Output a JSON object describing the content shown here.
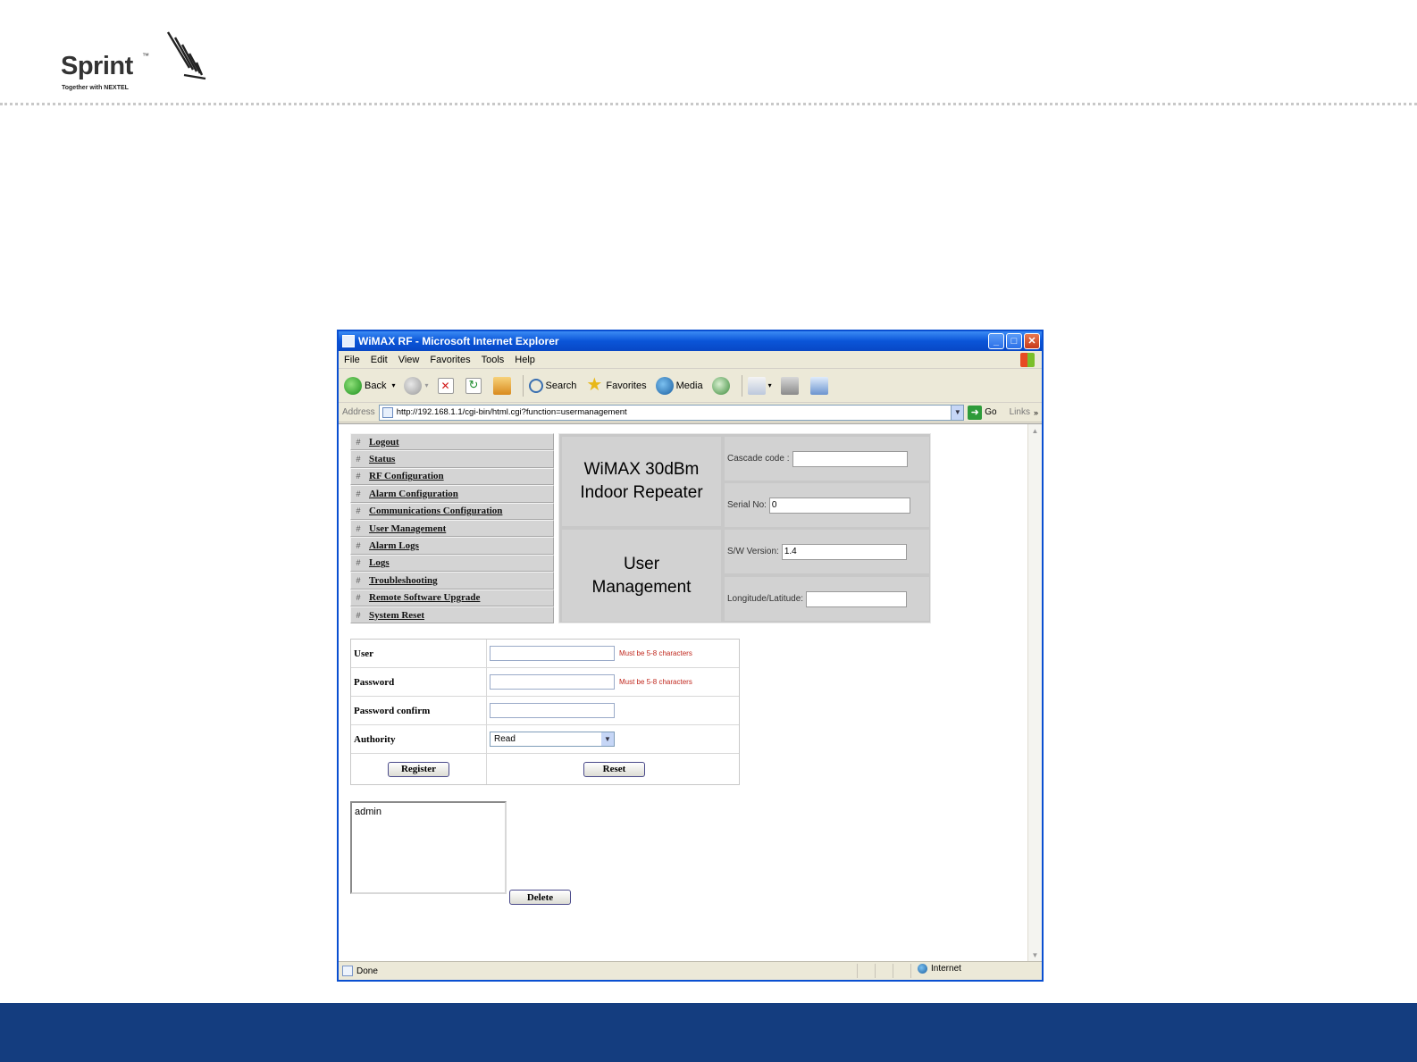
{
  "slide": {
    "brand": "Sprint",
    "tagline": "Together with NEXTEL",
    "footer_color": "#143d7f"
  },
  "window": {
    "title": "WiMAX RF - Microsoft Internet Explorer",
    "menu": [
      "File",
      "Edit",
      "View",
      "Favorites",
      "Tools",
      "Help"
    ],
    "toolbar": {
      "back": "Back",
      "search": "Search",
      "favorites": "Favorites",
      "media": "Media"
    },
    "address": {
      "label": "Address",
      "url": "http://192.168.1.1/cgi-bin/html.cgi?function=usermanagement",
      "go": "Go",
      "links": "Links"
    },
    "status": {
      "text": "Done",
      "zone": "Internet"
    }
  },
  "nav": {
    "items": [
      "Logout",
      "Status",
      "RF Configuration",
      "Alarm Configuration",
      "Communications Configuration",
      "User Management",
      "Alarm Logs",
      "Logs",
      "Troubleshooting",
      "Remote Software Upgrade",
      "System Reset"
    ]
  },
  "header": {
    "product_line1": "WiMAX 30dBm",
    "product_line2": "Indoor Repeater",
    "page_line1": "User",
    "page_line2": "Management",
    "cascade_label": "Cascade code :",
    "cascade_value": "",
    "serial_label": "Serial No:",
    "serial_value": "0",
    "sw_label": "S/W Version:",
    "sw_value": "1.4",
    "lonlat_label": "Longitude/Latitude:",
    "lonlat_value": ""
  },
  "form": {
    "user_label": "User",
    "user_hint": "Must be 5-8 characters",
    "password_label": "Password",
    "password_hint": "Must be 5-8 characters",
    "confirm_label": "Password confirm",
    "authority_label": "Authority",
    "authority_value": "Read",
    "register_label": "Register",
    "reset_label": "Reset"
  },
  "users": {
    "list": [
      "admin"
    ],
    "delete_label": "Delete"
  }
}
